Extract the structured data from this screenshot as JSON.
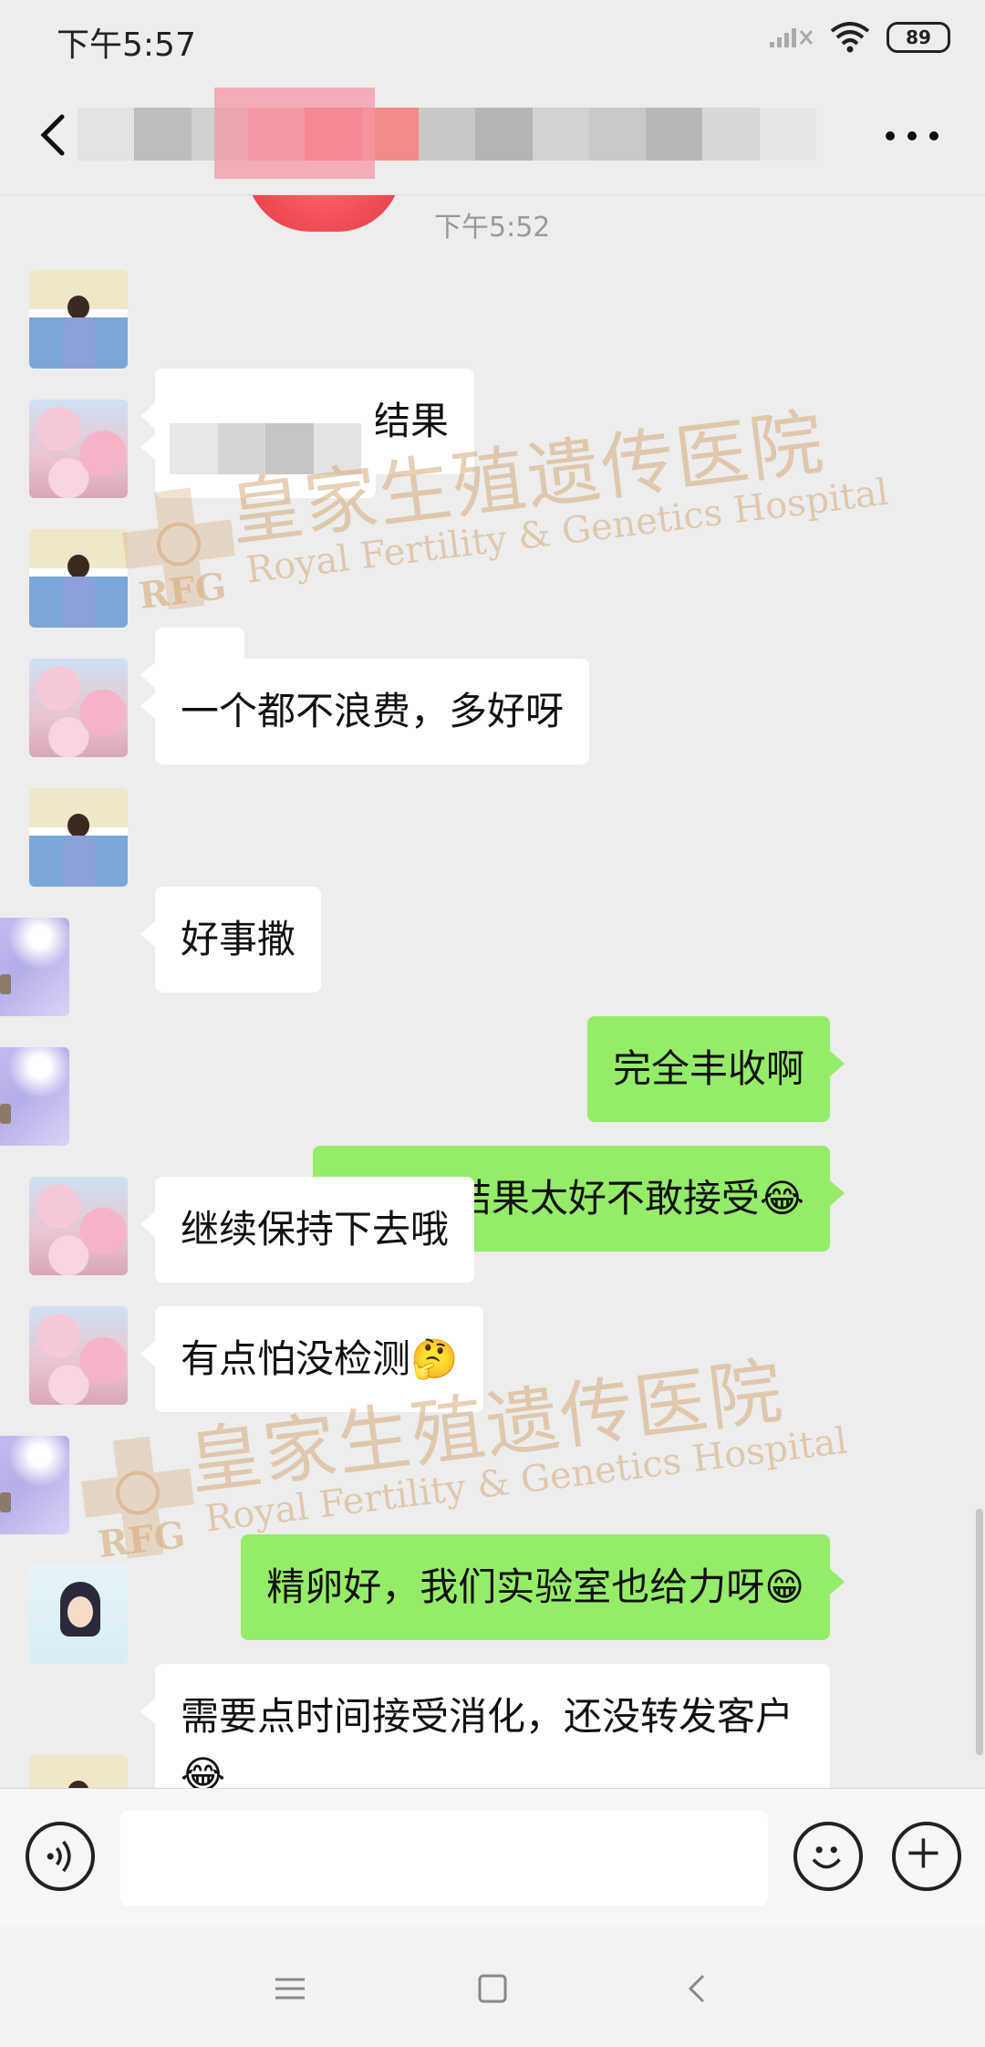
{
  "status_bar": {
    "time": "下午5:57",
    "battery": "89"
  },
  "header": {
    "title": ""
  },
  "chat": {
    "timestamp": "下午5:52",
    "messages": [
      {
        "side": "left",
        "avatar": "man",
        "text": "下午才出的结果"
      },
      {
        "side": "left",
        "avatar": "blossom",
        "text": ""
      },
      {
        "side": "left",
        "avatar": "man",
        "text": "😁"
      },
      {
        "side": "left",
        "avatar": "blossom",
        "text": "一个都不浪费，多好呀"
      },
      {
        "side": "left",
        "avatar": "man",
        "text": "好事撒"
      },
      {
        "side": "right",
        "avatar": "purple",
        "text": "完全丰收啊"
      },
      {
        "side": "right",
        "avatar": "purple",
        "text": "是不是结果太好不敢接受😂"
      },
      {
        "side": "left",
        "avatar": "blossom",
        "text": "继续保持下去哦"
      },
      {
        "side": "left",
        "avatar": "blossom",
        "text": "有点怕没检测🤔"
      },
      {
        "side": "right",
        "avatar": "purple",
        "text": "精卵好，我们实验室也给力呀😁"
      },
      {
        "side": "left",
        "avatar": "girl",
        "text": "需要点时间接受消化，还没转发客户😂"
      }
    ]
  },
  "watermark": {
    "name_cn": "皇家生殖遗传医院",
    "name_en": "Royal Fertility & Genetics Hospital",
    "logo_text": "RFG"
  },
  "input_bar": {
    "placeholder": ""
  },
  "icons": {
    "back": "back-arrow-icon",
    "more": "more-dots-icon",
    "voice": "voice-icon",
    "emoji": "emoji-icon",
    "plus": "plus-icon"
  }
}
